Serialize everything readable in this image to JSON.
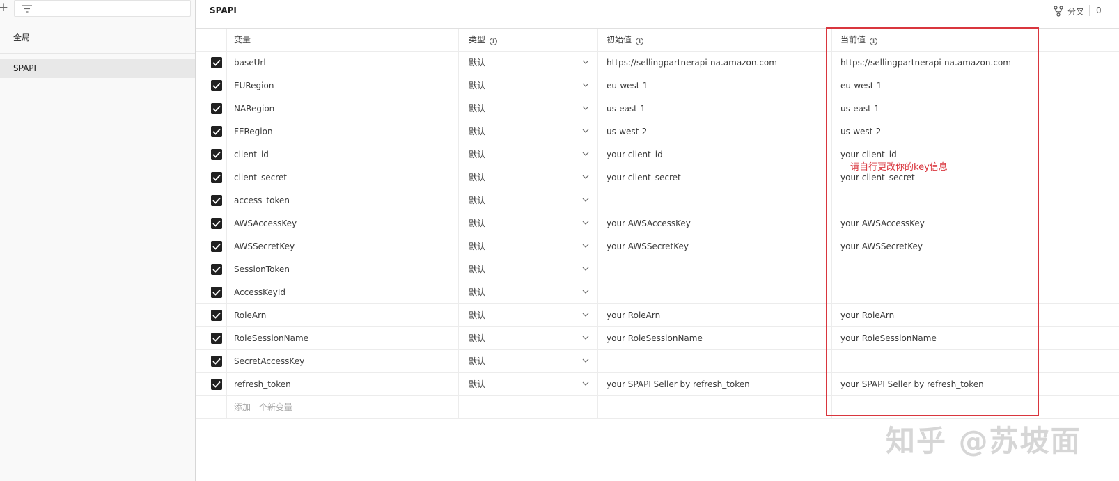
{
  "sidebar": {
    "add_icon": "plus-icon",
    "filter_icon": "filter-icon",
    "global_label": "全局",
    "items": [
      {
        "label": "SPAPI"
      }
    ]
  },
  "header": {
    "title": "SPAPI",
    "fork_label": "分叉",
    "fork_count": "0",
    "fork_icon": "fork-icon"
  },
  "table": {
    "columns": {
      "key": "变量",
      "type": "类型",
      "initial": "初始值",
      "current": "当前值"
    },
    "rows": [
      {
        "key": "baseUrl",
        "type": "默认",
        "initial": "https://sellingpartnerapi-na.amazon.com",
        "current": "https://sellingpartnerapi-na.amazon.com",
        "checked": true
      },
      {
        "key": "EURegion",
        "type": "默认",
        "initial": "eu-west-1",
        "current": "eu-west-1",
        "checked": true
      },
      {
        "key": "NARegion",
        "type": "默认",
        "initial": "us-east-1",
        "current": "us-east-1",
        "checked": true
      },
      {
        "key": "FERegion",
        "type": "默认",
        "initial": "us-west-2",
        "current": "us-west-2",
        "checked": true
      },
      {
        "key": "client_id",
        "type": "默认",
        "initial": "your client_id",
        "current": "your client_id",
        "checked": true
      },
      {
        "key": "client_secret",
        "type": "默认",
        "initial": "your client_secret",
        "current": "your client_secret",
        "checked": true
      },
      {
        "key": "access_token",
        "type": "默认",
        "initial": "",
        "current": "",
        "checked": true
      },
      {
        "key": "AWSAccessKey",
        "type": "默认",
        "initial": "your AWSAccessKey",
        "current": "your AWSAccessKey",
        "checked": true
      },
      {
        "key": "AWSSecretKey",
        "type": "默认",
        "initial": "your AWSSecretKey",
        "current": "your AWSSecretKey",
        "checked": true
      },
      {
        "key": "SessionToken",
        "type": "默认",
        "initial": "",
        "current": "",
        "checked": true
      },
      {
        "key": "AccessKeyId",
        "type": "默认",
        "initial": "",
        "current": "",
        "checked": true
      },
      {
        "key": "RoleArn",
        "type": "默认",
        "initial": "your RoleArn",
        "current": "your RoleArn",
        "checked": true
      },
      {
        "key": "RoleSessionName",
        "type": "默认",
        "initial": "your RoleSessionName",
        "current": "your RoleSessionName",
        "checked": true
      },
      {
        "key": "SecretAccessKey",
        "type": "默认",
        "initial": "",
        "current": "",
        "checked": true
      },
      {
        "key": "refresh_token",
        "type": "默认",
        "initial": "your SPAPI Seller by refresh_token",
        "current": "your SPAPI Seller by refresh_token",
        "checked": true
      }
    ],
    "add_placeholder": "添加一个新变量"
  },
  "annotation": {
    "text": "请自行更改你的key信息",
    "color": "#d9363e"
  },
  "watermark": "知乎 @苏坡面",
  "colors": {
    "checkbox": "#212121",
    "selected_item_bg": "#e8e8e8",
    "annotation_red": "#d9363e"
  }
}
